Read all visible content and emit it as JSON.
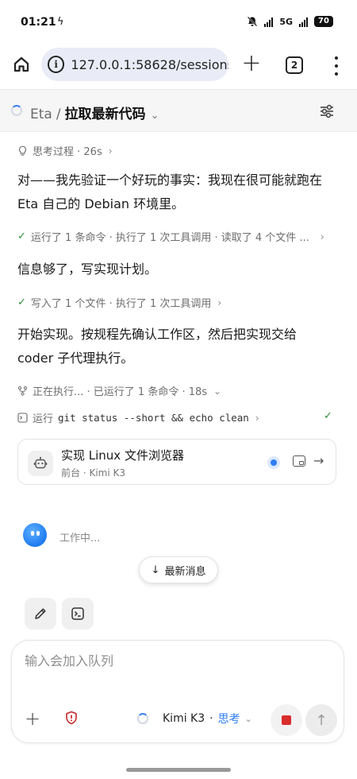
{
  "status_bar": {
    "time": "01:21",
    "charging_icon": "bolt-icon",
    "network_label": "5G",
    "battery": "70"
  },
  "browser": {
    "url": "127.0.0.1:58628/sessions",
    "tab_count": "2"
  },
  "header": {
    "project": "Eta",
    "separator": "/",
    "session_title": "拉取最新代码"
  },
  "thinking": {
    "label": "思考过程 · 26s"
  },
  "messages": [
    "对——我先验证一个好玩的事实：我现在很可能就跑在 Eta 自己的 Debian 环境里。",
    "信息够了，写实现计划。",
    "开始实现。按规程先确认工作区，然后把实现交给 coder 子代理执行。"
  ],
  "activity": [
    "运行了 1 条命令 · 执行了 1 次工具调用 · 读取了 4 个文件 ...",
    "写入了 1 个文件 · 执行了 1 次工具调用"
  ],
  "executing": {
    "label": "正在执行... · 已运行了 1 条命令 · 18s"
  },
  "command": {
    "prefix": "运行",
    "code": "git status --short && echo clean"
  },
  "agent_card": {
    "title": "实现 Linux 文件浏览器",
    "subtitle": "前台 · Kimi K3",
    "status_color": "#2f7df6"
  },
  "working": {
    "label": "工作中..."
  },
  "latest_button": {
    "label": "最新消息"
  },
  "composer": {
    "placeholder": "输入会加入队列",
    "model": "Kimi K3",
    "dot": "·",
    "mode": "思考"
  },
  "colors": {
    "accent": "#2f7df6",
    "success": "#2f8f3a",
    "stop": "#d92c2c",
    "header_bg": "#f6f6f6"
  }
}
